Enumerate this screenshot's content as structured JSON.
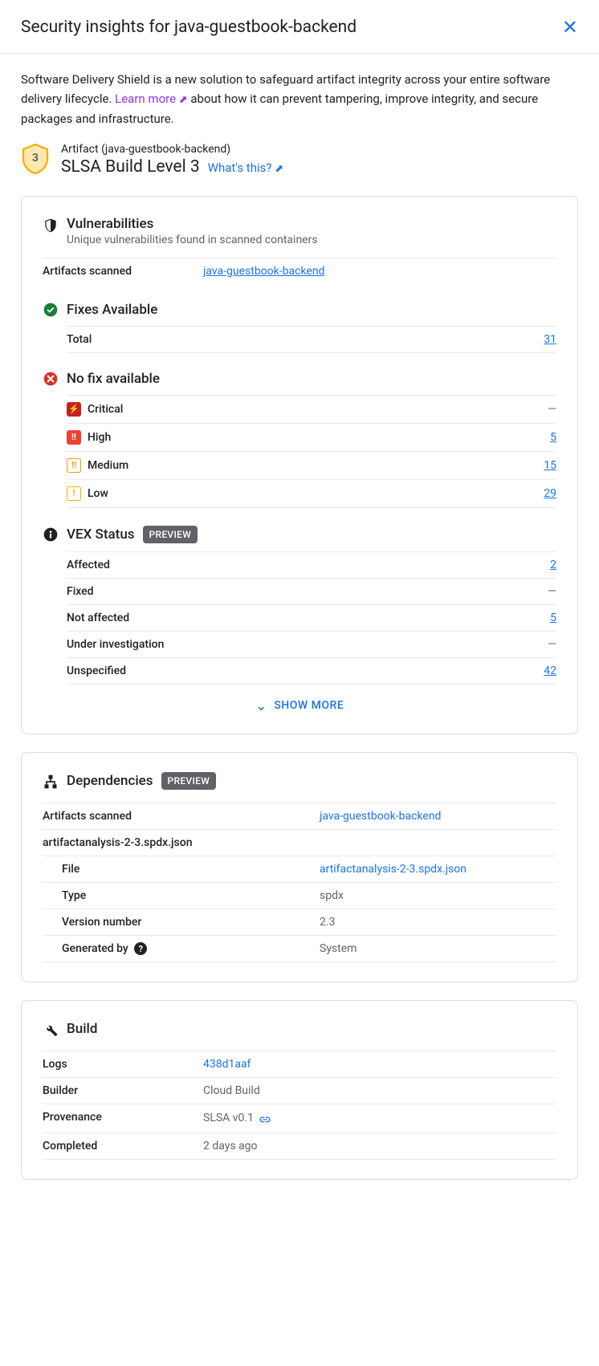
{
  "header": {
    "title": "Security insights for java-guestbook-backend"
  },
  "intro": {
    "text_before": "Software Delivery Shield is a new solution to safeguard artifact integrity across your entire software delivery lifecycle. ",
    "link_text": "Learn more",
    "text_after": " about how it can prevent tampering, improve integrity, and secure packages and infrastructure."
  },
  "artifact": {
    "label": "Artifact (java-guestbook-backend)",
    "slsa_level": "3",
    "slsa_title": "SLSA Build Level 3",
    "whats_this": "What's this?"
  },
  "vulnerabilities": {
    "title": "Vulnerabilities",
    "subtitle": "Unique vulnerabilities found in scanned containers",
    "artifacts_scanned_label": "Artifacts scanned",
    "artifacts_scanned_value": "java-guestbook-backend",
    "fixes": {
      "title": "Fixes Available",
      "total_label": "Total",
      "total_value": "31"
    },
    "no_fix": {
      "title": "No fix available",
      "rows": [
        {
          "severity": "Critical",
          "value": "—",
          "is_link": false
        },
        {
          "severity": "High",
          "value": "5",
          "is_link": true
        },
        {
          "severity": "Medium",
          "value": "15",
          "is_link": true
        },
        {
          "severity": "Low",
          "value": "29",
          "is_link": true
        }
      ]
    },
    "vex": {
      "title": "VEX Status",
      "badge": "PREVIEW",
      "rows": [
        {
          "label": "Affected",
          "value": "2",
          "is_link": true
        },
        {
          "label": "Fixed",
          "value": "—",
          "is_link": false
        },
        {
          "label": "Not affected",
          "value": "5",
          "is_link": true
        },
        {
          "label": "Under investigation",
          "value": "—",
          "is_link": false
        },
        {
          "label": "Unspecified",
          "value": "42",
          "is_link": true
        }
      ]
    },
    "show_more": "SHOW MORE"
  },
  "dependencies": {
    "title": "Dependencies",
    "badge": "PREVIEW",
    "artifacts_scanned_label": "Artifacts scanned",
    "artifacts_scanned_value": "java-guestbook-backend",
    "group": "artifactanalysis-2-3.spdx.json",
    "rows": [
      {
        "label": "File",
        "value": "artifactanalysis-2-3.spdx.json",
        "is_link": true
      },
      {
        "label": "Type",
        "value": "spdx",
        "is_link": false
      },
      {
        "label": "Version number",
        "value": "2.3",
        "is_link": false
      },
      {
        "label": "Generated by",
        "value": "System",
        "is_link": false,
        "help": true
      }
    ]
  },
  "build": {
    "title": "Build",
    "rows": [
      {
        "label": "Logs",
        "value": "438d1aaf",
        "type": "link"
      },
      {
        "label": "Builder",
        "value": "Cloud Build",
        "type": "text"
      },
      {
        "label": "Provenance",
        "value": "SLSA v0.1",
        "type": "link-icon"
      },
      {
        "label": "Completed",
        "value": "2 days ago",
        "type": "text"
      }
    ]
  }
}
